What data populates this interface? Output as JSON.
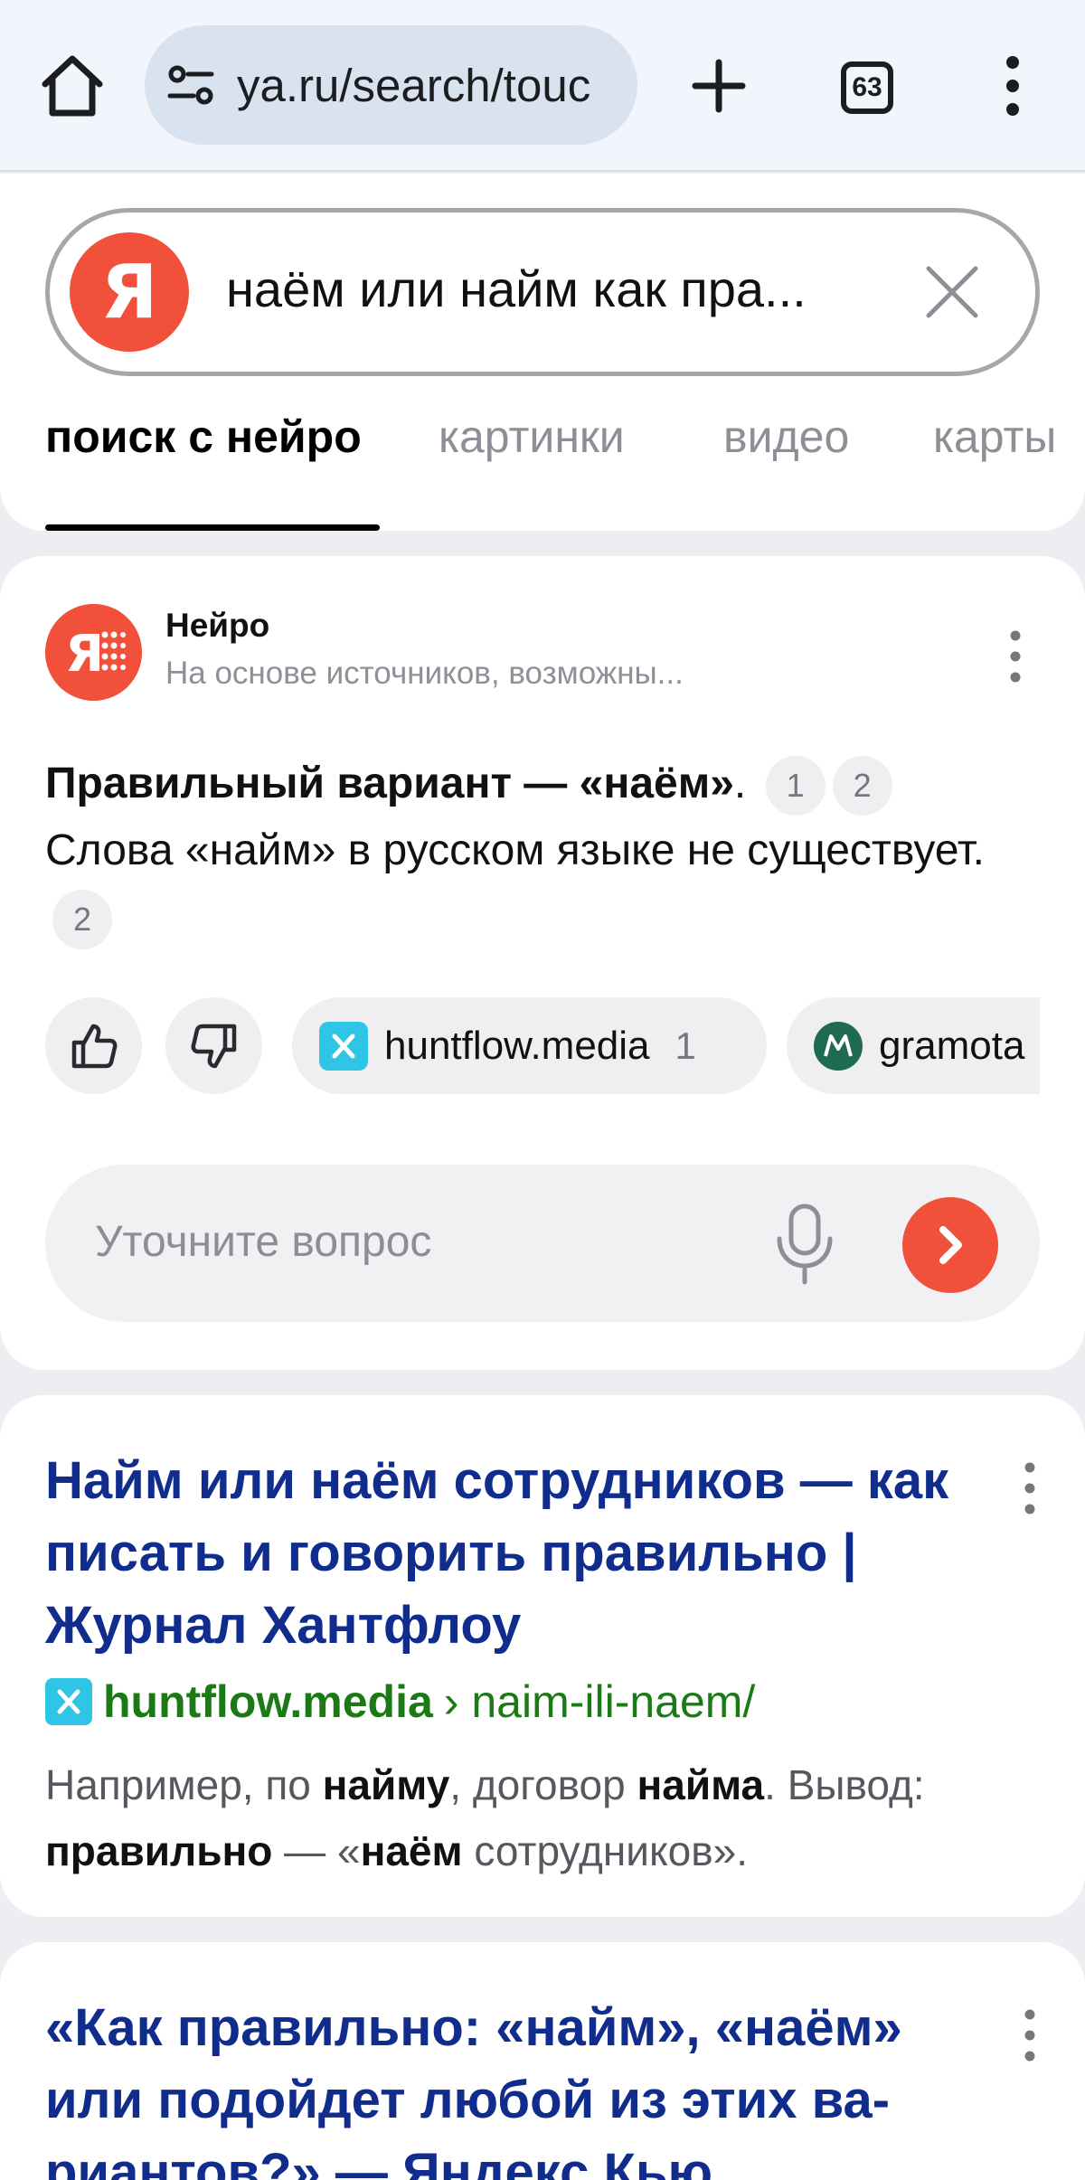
{
  "browser": {
    "url": "ya.ru/search/touc",
    "tabs_count": "63"
  },
  "search": {
    "logo_letter": "Я",
    "query": "наём или найм как пра..."
  },
  "nav_tabs": [
    {
      "label": "поиск с нейро",
      "active": true
    },
    {
      "label": "картинки",
      "active": false
    },
    {
      "label": "видео",
      "active": false
    },
    {
      "label": "карты",
      "active": false
    }
  ],
  "neuro": {
    "name": "Нейро",
    "subtitle": "На основе источников, возможны...",
    "answer_bold": "Правильный вариант — «наём»",
    "answer_bold_tail": ".",
    "ref_a": "1",
    "ref_b": "2",
    "answer_line2": "Слова «найм» в русском языке не существует.",
    "ref_c": "2",
    "sources": [
      {
        "label": "huntflow.media",
        "count": "1"
      },
      {
        "label": "gramota"
      }
    ],
    "ask_placeholder": "Уточните вопрос"
  },
  "results": [
    {
      "title": "Найм или наём сотрудников — как писать и говорить правильно | Журнал Хантфлоу",
      "domain": "huntflow.media",
      "path": "› naim-ili-naem/",
      "snippet": {
        "p1": "Например, по ",
        "b1": "найму",
        "p2": ", договор ",
        "b2": "найма",
        "p3": ". Вы­вод: ",
        "b3": "правильно",
        "p4": " — «",
        "b4": "наём",
        "p5": " сотрудников»."
      }
    },
    {
      "title": "«Как правильно: «найм», «наём» или подойдет любой из этих ва­риантов?» — Яндекс Кью"
    }
  ],
  "colors": {
    "yandex_red": "#f1513b",
    "link_blue": "#102c8c",
    "url_green": "#1c7a16",
    "huntflow_cyan": "#2fc6e5",
    "gramota_green": "#1f6b52"
  }
}
